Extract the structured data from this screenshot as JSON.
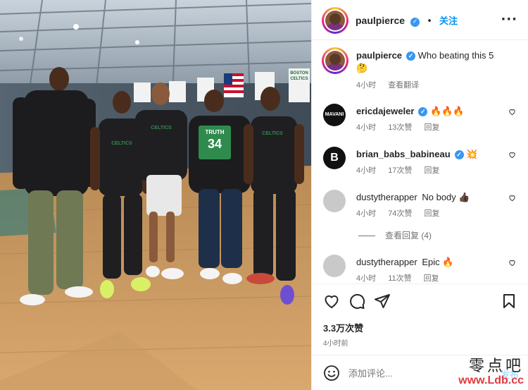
{
  "post": {
    "image_alt": "Five basketball players standing on a gym court",
    "jersey_text": "TRUTH",
    "jersey_number": "34",
    "shirt_text": "CELTICS",
    "banner_text": "BOSTON CELTICS"
  },
  "header": {
    "username": "paulpierce",
    "separator": "•",
    "follow_label": "关注",
    "more_label": "···"
  },
  "caption": {
    "username": "paulpierce",
    "text": "Who beating this 5 🤔",
    "time": "4小时",
    "translate_label": "查看翻译"
  },
  "comments": [
    {
      "username": "ericdajeweler",
      "text": "🔥🔥🔥",
      "time": "4小时",
      "likes": "13次赞",
      "reply_label": "回复",
      "avatar_text": "MAVANI"
    },
    {
      "username": "brian_babs_babineau",
      "text": "💥",
      "time": "4小时",
      "likes": "17次赞",
      "reply_label": "回复",
      "avatar_text": "B"
    },
    {
      "username": "dustytherapper",
      "text": "No body 👍🏿",
      "time": "4小时",
      "likes": "74次赞",
      "reply_label": "回复",
      "avatar_text": ""
    },
    {
      "username": "dustytherapper",
      "text": "Epic 🔥",
      "time": "4小时",
      "likes": "11次赞",
      "reply_label": "回复",
      "avatar_text": ""
    }
  ],
  "view_replies_label": "查看回复 (4)",
  "actions": {
    "like_icon": "heart-icon",
    "comment_icon": "comment-icon",
    "share_icon": "share-icon",
    "save_icon": "bookmark-icon"
  },
  "likes_count": "3.3万次赞",
  "post_time": "4小时前",
  "add_comment": {
    "placeholder": "添加评论...",
    "post_label": "发布"
  },
  "watermark": {
    "line1": "零点吧",
    "line2": "www.Ldb.cc"
  },
  "colors": {
    "accent": "#0095f6",
    "verified": "#3897f0",
    "text_secondary": "#737373"
  }
}
